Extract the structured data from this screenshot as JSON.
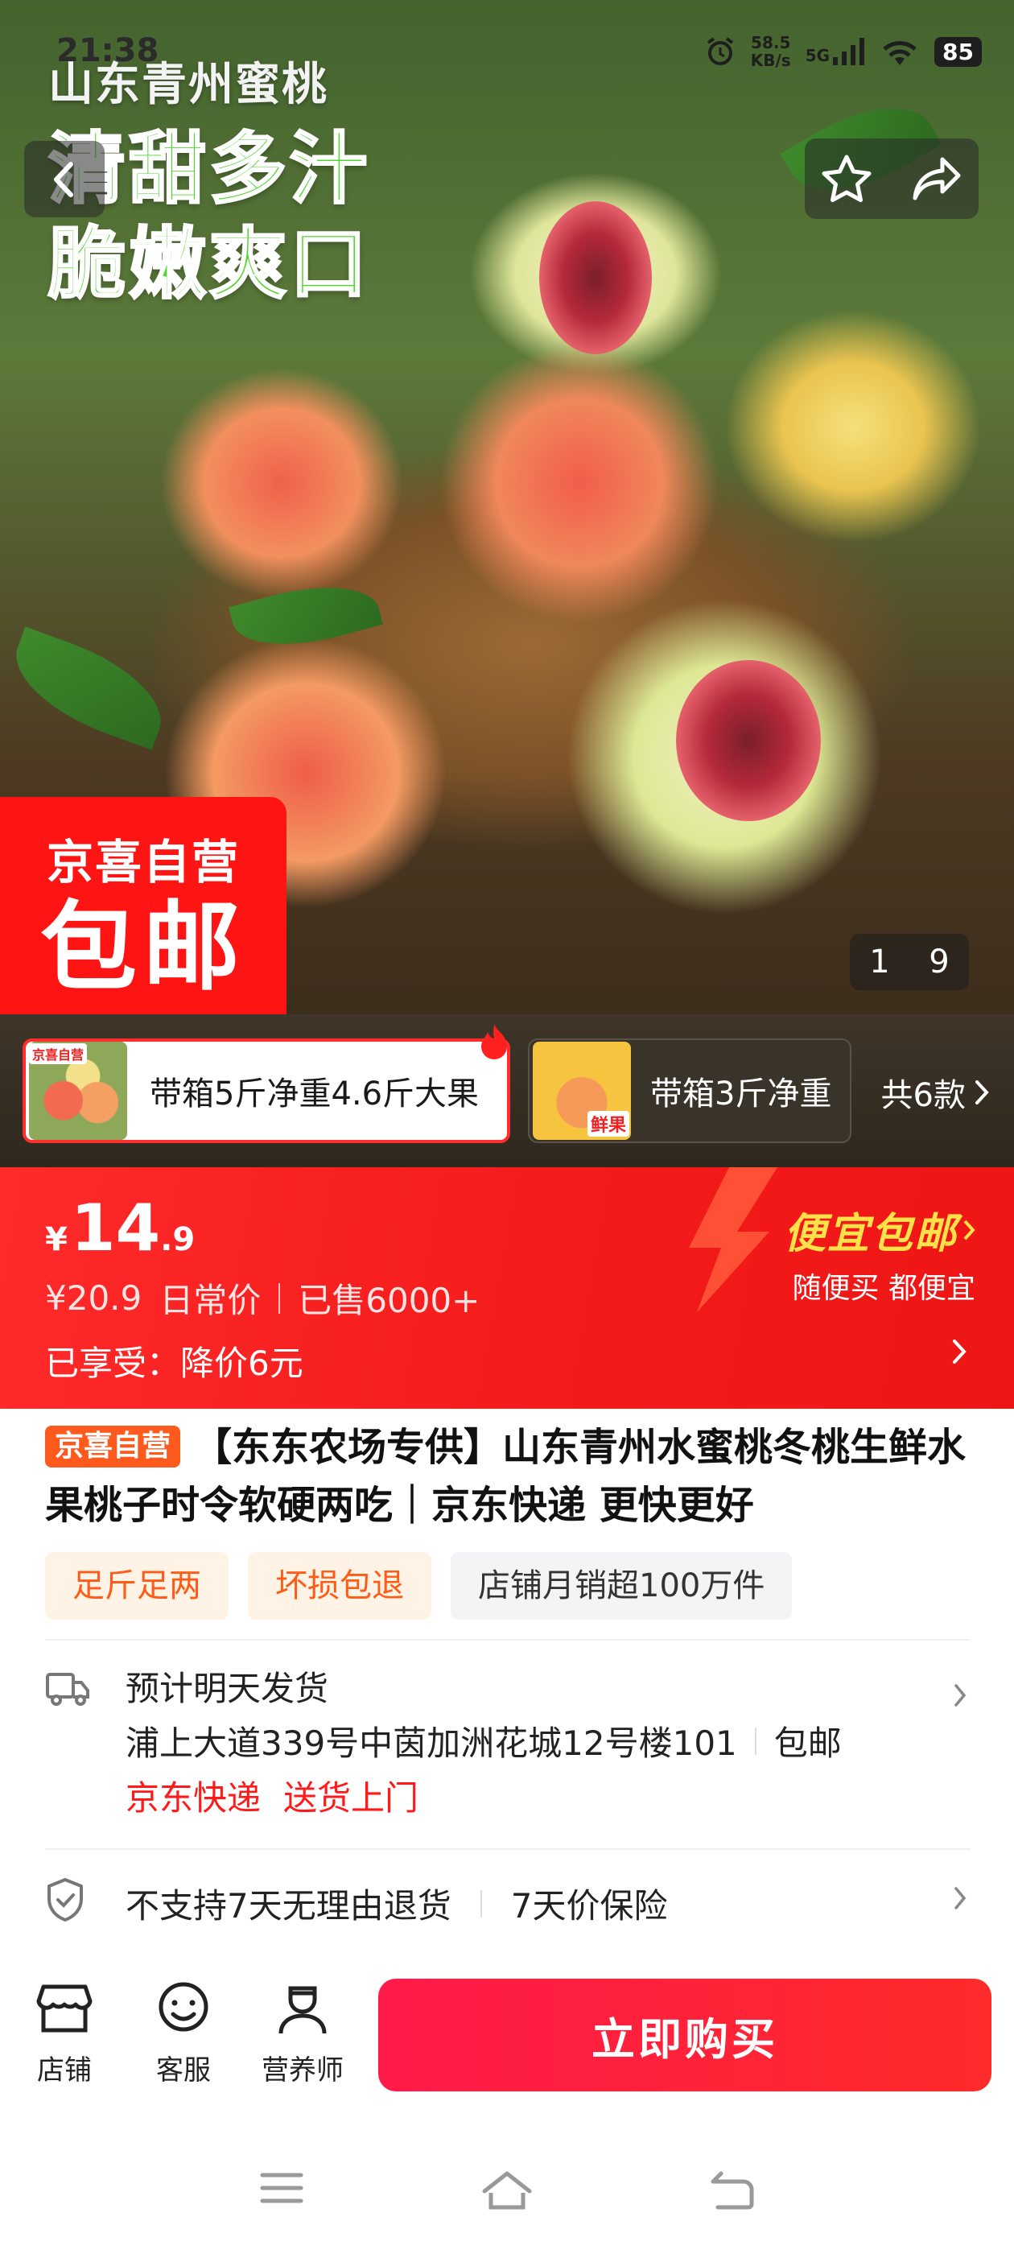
{
  "status_bar": {
    "time": "21:38",
    "net_speed": "58.5",
    "net_unit": "KB/s",
    "network": "5G",
    "battery": "85"
  },
  "hero": {
    "subtitle": "山东青州蜜桃",
    "headline_1": "清甜多汁",
    "headline_2": "脆嫩爽口",
    "promo_badge_1": "京喜自营",
    "promo_badge_2": "包邮",
    "counter_current": "1",
    "counter_total": "9"
  },
  "variants": {
    "selected_label": "带箱5斤净重4.6斤大果",
    "selected_thumb_tag": "京喜自营",
    "other_label": "带箱3斤净重",
    "other_thumb_tag": "鲜果",
    "total_label": "共6款"
  },
  "price": {
    "currency": "¥",
    "integer": "14",
    "decimal": ".9",
    "daily_price": "¥20.9",
    "daily_price_label": "日常价",
    "sold": "已售6000+",
    "applied": "已享受：降价6元",
    "promo_title": "便宜包邮",
    "promo_sub": "随便买 都便宜"
  },
  "product": {
    "badge": "京喜自营",
    "title": "【东东农场专供】山东青州水蜜桃冬桃生鲜水果桃子时令软硬两吃｜京东快递 更快更好",
    "tags": [
      "足斤足两",
      "坏损包退",
      "店铺月销超100万件"
    ]
  },
  "delivery": {
    "title": "预计明天发货",
    "address": "浦上大道339号中茵加洲花城12号楼101",
    "shipping_fee": "包邮",
    "carrier": "京东快递",
    "service": "送货上门"
  },
  "returns": {
    "policy": "不支持7天无理由退货",
    "price_protect": "7天价保险"
  },
  "action_bar": {
    "store": "店铺",
    "service": "客服",
    "nutritionist": "营养师",
    "buy_now": "立即购买"
  },
  "colors": {
    "brand_red": "#ff1a1a",
    "promo_yellow": "#ffe14a",
    "tag_orange": "#ff5b17"
  }
}
